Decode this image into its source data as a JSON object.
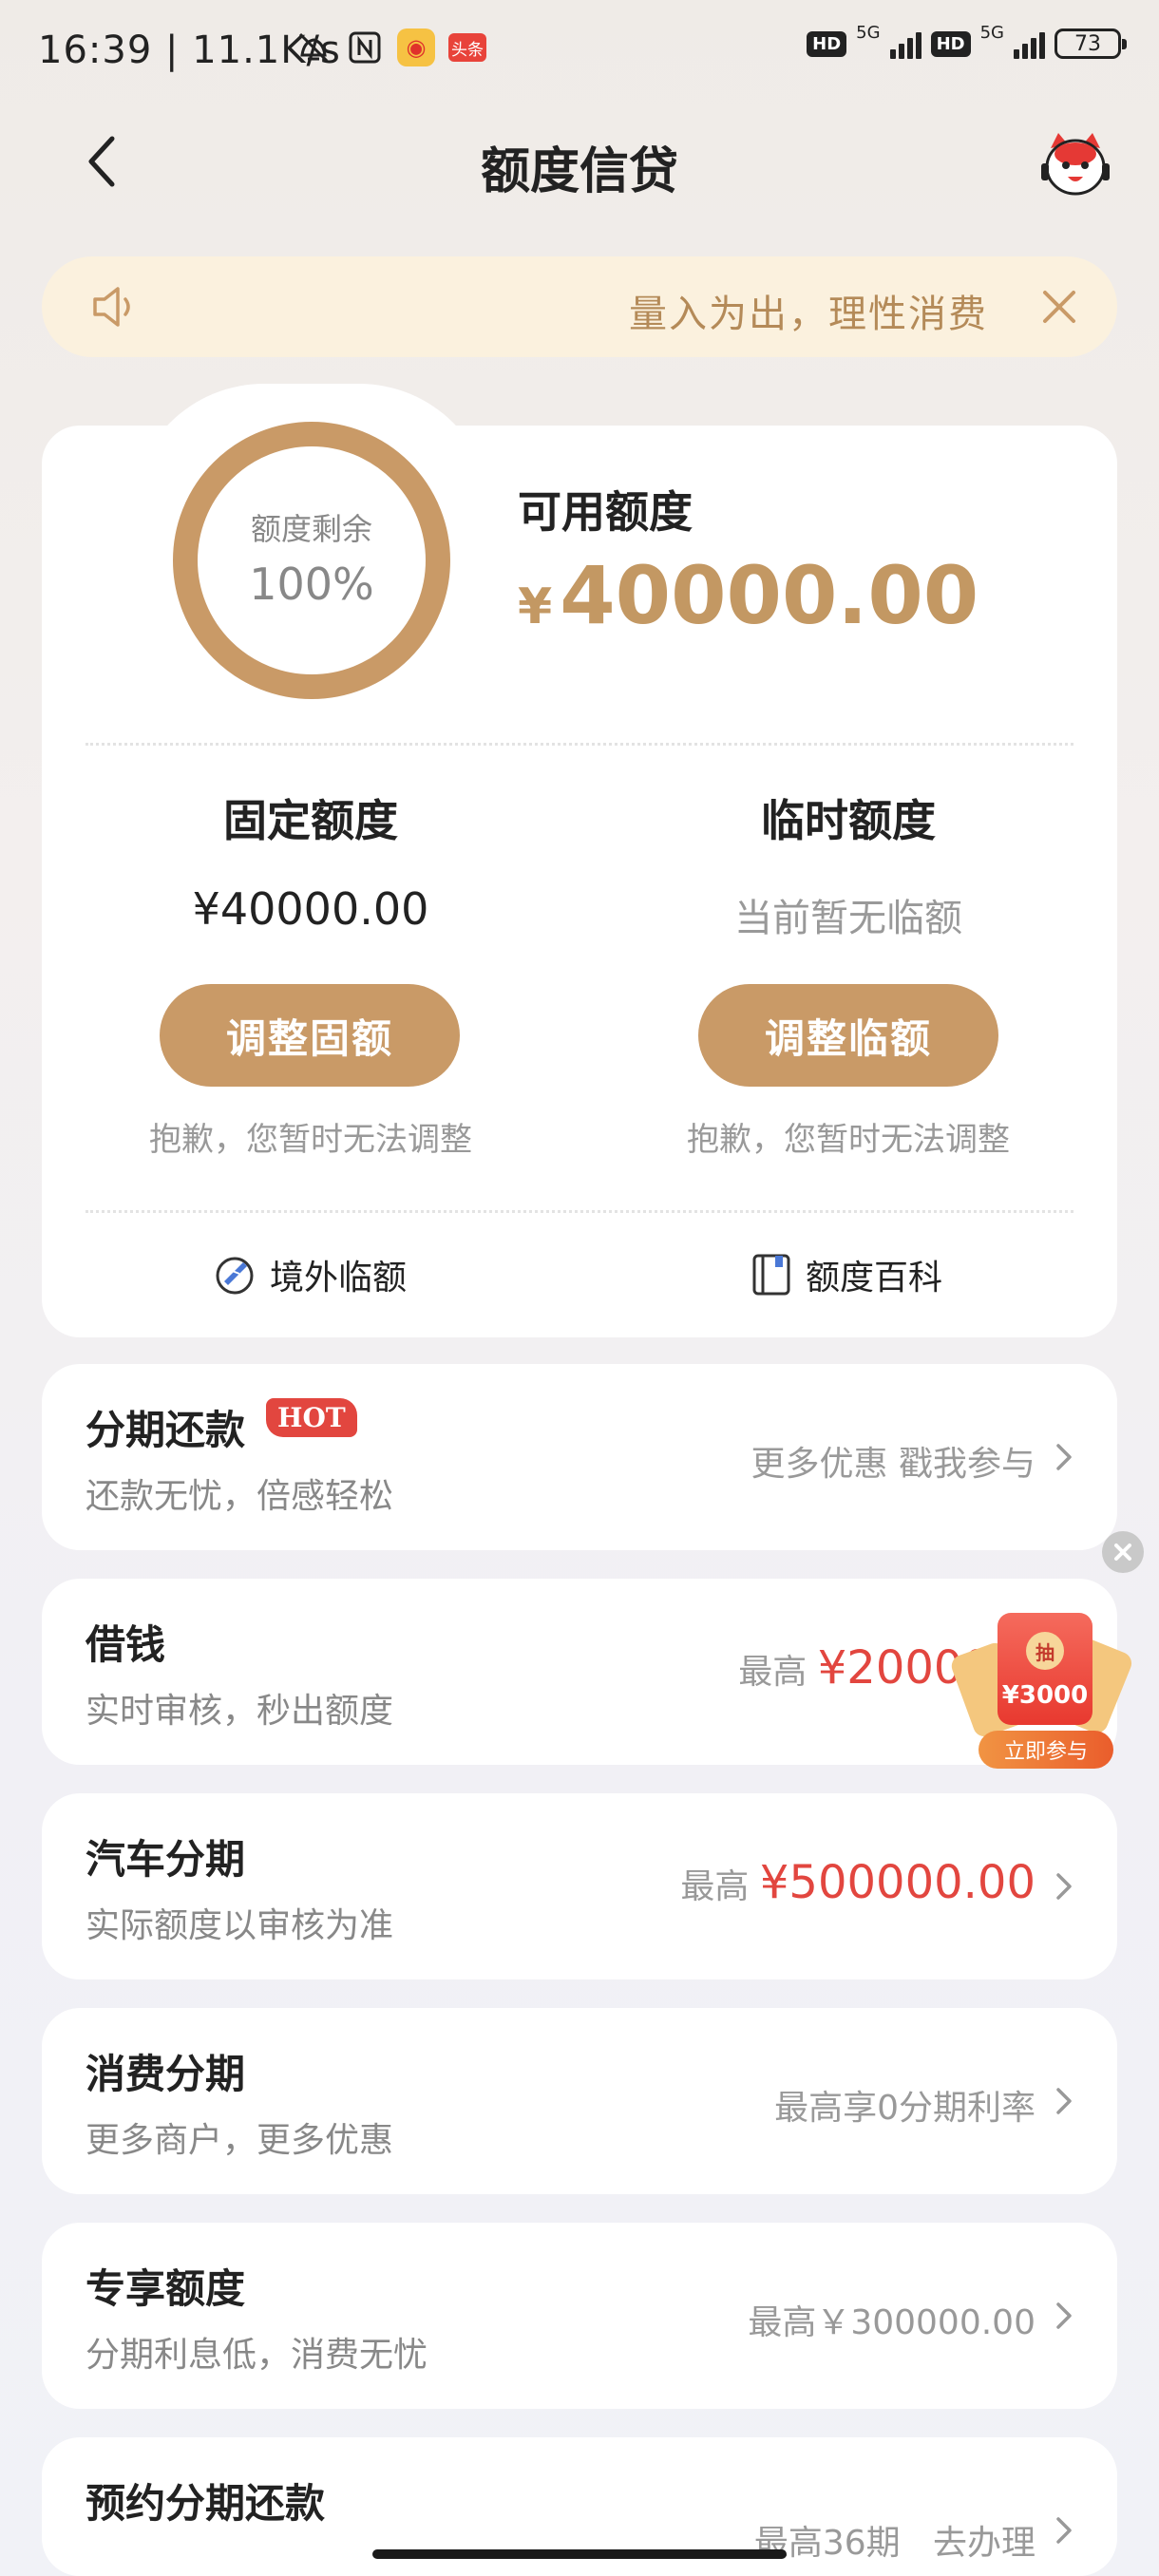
{
  "status_bar": {
    "time": "16:39",
    "speed": "11.1K/s",
    "toutiao": "头条",
    "net1": "5G",
    "net2": "5G",
    "hd": "HD",
    "battery": "73"
  },
  "header": {
    "title": "额度信贷"
  },
  "notice": {
    "text": "量入为出，理性消费"
  },
  "quota": {
    "ring_label": "额度剩余",
    "ring_percent": "100%",
    "remaining_fraction": 1.0,
    "available_label": "可用额度",
    "currency": "¥",
    "available_value": "40000.00",
    "fixed": {
      "title": "固定额度",
      "value": "¥40000.00",
      "button": "调整固额",
      "note": "抱歉，您暂时无法调整"
    },
    "temporary": {
      "title": "临时额度",
      "value": "当前暂无临额",
      "button": "调整临额",
      "note": "抱歉，您暂时无法调整"
    },
    "links": {
      "overseas": "境外临额",
      "wiki": "额度百科"
    }
  },
  "services": [
    {
      "title": "分期还款",
      "badge": "HOT",
      "subtitle": "还款无忧，倍感轻松",
      "right": "更多优惠 戳我参与"
    },
    {
      "title": "借钱",
      "subtitle": "实时审核，秒出额度",
      "prefix": "最高",
      "amount": "¥20000"
    },
    {
      "title": "汽车分期",
      "subtitle": "实际额度以审核为准",
      "prefix": "最高",
      "amount": "¥500000.00"
    },
    {
      "title": "消费分期",
      "subtitle": "更多商户，更多优惠",
      "right": "最高享0分期利率"
    },
    {
      "title": "专享额度",
      "subtitle": "分期利息低，消费无忧",
      "right": "最高￥300000.00"
    },
    {
      "title": "预约分期还款",
      "right": "最高36期   去办理"
    }
  ],
  "promo": {
    "amount": "¥3000",
    "coin": "抽",
    "button": "立即参与"
  },
  "colors": {
    "accent": "#c99a67",
    "accent_text": "#c39863",
    "red": "#e2463f",
    "notice_bg": "#fbf1de"
  }
}
